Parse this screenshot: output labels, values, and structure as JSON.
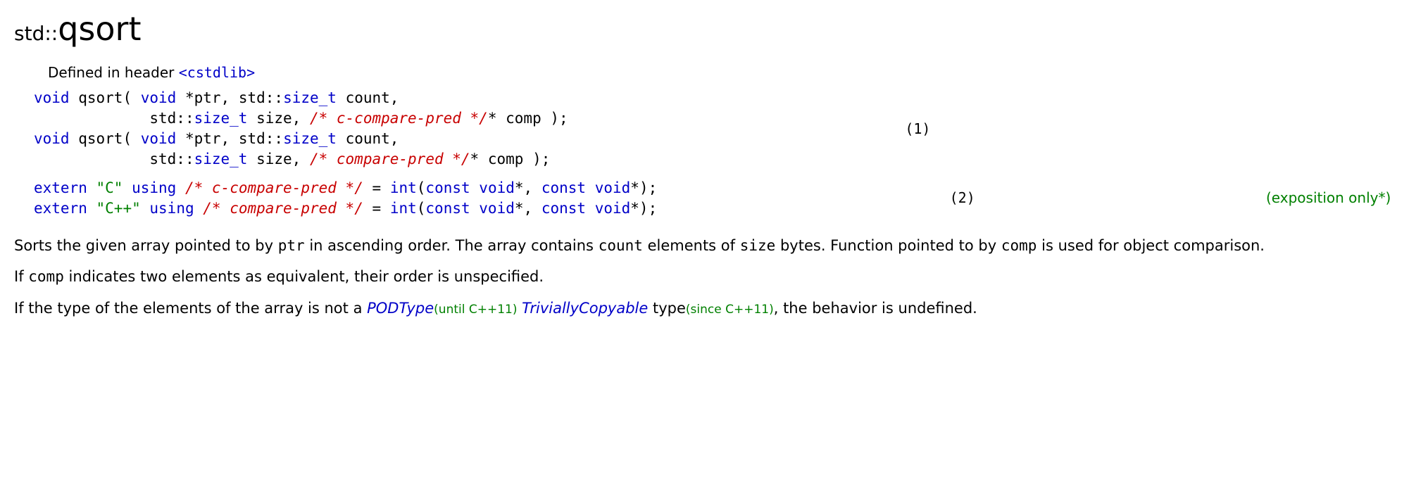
{
  "title": {
    "namespace": "std::",
    "name": "qsort"
  },
  "defined_in": {
    "prefix": "Defined in header ",
    "header": "<cstdlib>"
  },
  "decl1": {
    "line1": {
      "a": "void",
      "b": " qsort",
      "c": "(",
      "d": " void ",
      "e": "*",
      "f": "ptr, std",
      "g": "::",
      "h": "size_t",
      "i": " count,"
    },
    "line2": {
      "a": "             std",
      "b": "::",
      "c": "size_t",
      "d": " size, ",
      "e": "/* c-compare-pred */",
      "f": "*",
      "g": " comp ",
      "h": ")",
      "i": ";"
    },
    "line3": {
      "a": "void",
      "b": " qsort",
      "c": "(",
      "d": " void ",
      "e": "*",
      "f": "ptr, std",
      "g": "::",
      "h": "size_t",
      "i": " count,"
    },
    "line4": {
      "a": "             std",
      "b": "::",
      "c": "size_t",
      "d": " size, ",
      "e": "/* compare-pred */",
      "f": "*",
      "g": " comp ",
      "h": ")",
      "i": ";"
    },
    "num": "(1)"
  },
  "decl2": {
    "line1": {
      "a": "extern",
      "b": " ",
      "c": "\"C\"",
      "d": " ",
      "e": "using",
      "f": " ",
      "g": "/* c-compare-pred */",
      "h": " ",
      "i": "=",
      "j": " ",
      "k": "int",
      "l": "(",
      "m": "const",
      "n": " ",
      "o": "void",
      "p": "*",
      "q": ", ",
      "r": "const",
      "s": " ",
      "t": "void",
      "u": "*",
      "v": ")",
      "w": ";"
    },
    "line2": {
      "a": "extern",
      "b": " ",
      "c": "\"C++\"",
      "d": " ",
      "e": "using",
      "f": " ",
      "g": "/* compare-pred */",
      "h": " ",
      "i": "=",
      "j": " ",
      "k": "int",
      "l": "(",
      "m": "const",
      "n": " ",
      "o": "void",
      "p": "*",
      "q": ", ",
      "r": "const",
      "s": " ",
      "t": "void",
      "u": "*",
      "v": ")",
      "w": ";"
    },
    "num": "(2)",
    "note": "(exposition only*)"
  },
  "para1": {
    "a": "Sorts the given array pointed to by ",
    "b": "ptr",
    "c": " in ascending order. The array contains ",
    "d": "count",
    "e": " elements of ",
    "f": "size",
    "g": " bytes. Function pointed to by ",
    "h": "comp",
    "i": " is used for object comparison."
  },
  "para2": {
    "a": "If ",
    "b": "comp",
    "c": " indicates two elements as equivalent, their order is unspecified."
  },
  "para3": {
    "a": "If the type of the elements of the array is not a ",
    "b": "PODType",
    "c": "(until C++11)",
    "d": "TriviallyCopyable",
    "e": " type",
    "f": "(since C++11)",
    "g": ", the behavior is undefined."
  }
}
